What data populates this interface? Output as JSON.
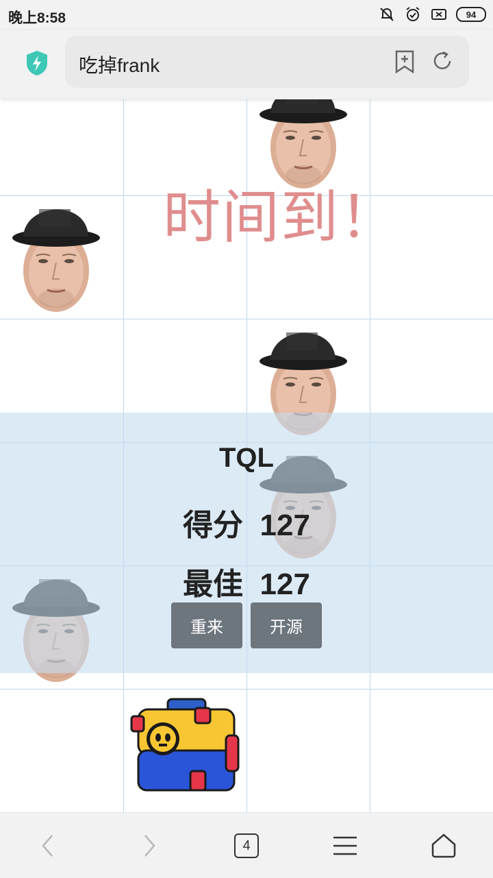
{
  "status_bar": {
    "time": "晚上8:58",
    "battery": "94",
    "icons": [
      "bell-off-icon",
      "alarm-icon",
      "sim-x-icon",
      "battery-icon"
    ]
  },
  "browser": {
    "url_text": "吃掉frank",
    "shield_color": "#3ec7b5",
    "actions": [
      "bookmark-add-icon",
      "refresh-icon"
    ]
  },
  "game": {
    "times_up": "时间到！",
    "times_up_color": "#e08d8d",
    "grid_line_color": "#bcd7ea",
    "overlay": {
      "title": "TQL",
      "score_label": "得分",
      "score_value": "127",
      "best_label": "最佳",
      "best_value": "127",
      "restart_label": "重来",
      "open_source_label": "开源"
    }
  },
  "bottom_nav": {
    "tab_count": "4",
    "items": [
      "back-icon",
      "forward-icon",
      "tabs-icon",
      "menu-icon",
      "home-icon"
    ]
  }
}
